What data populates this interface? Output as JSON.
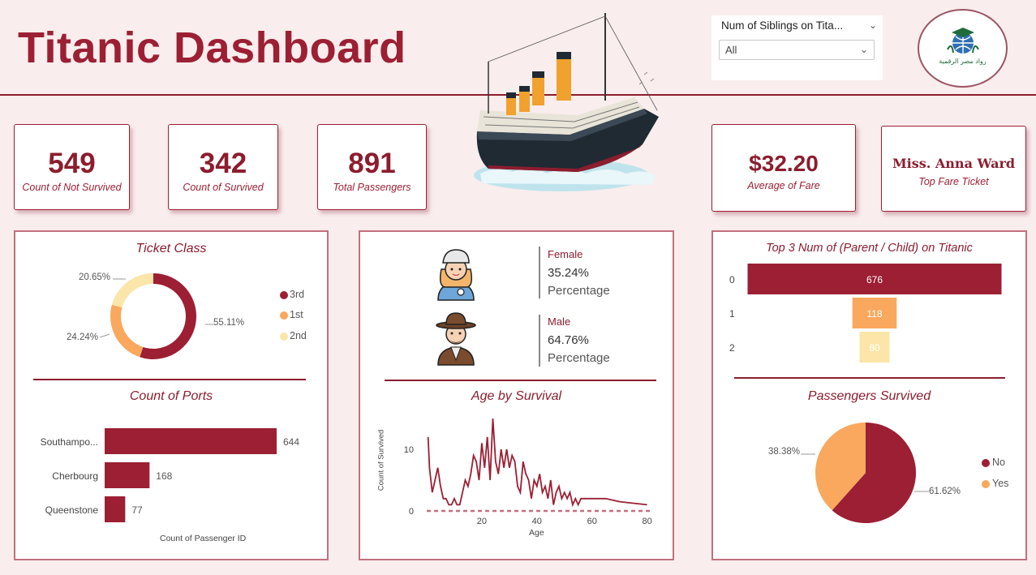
{
  "header": {
    "title": "Titanic Dashboard"
  },
  "slicer": {
    "label": "Num of Siblings on Tita...",
    "value": "All"
  },
  "logo": {
    "text": "رواد مصر الرقمية"
  },
  "kpis": {
    "not_survived": {
      "value": "549",
      "label": "Count of Not Survived"
    },
    "survived": {
      "value": "342",
      "label": "Count of Survived"
    },
    "total": {
      "value": "891",
      "label": "Total Passengers"
    },
    "avg_fare": {
      "value": "$32.20",
      "label": "Average of Fare"
    },
    "top_fare": {
      "value": "Miss. Anna Ward",
      "label": "Top Fare Ticket"
    }
  },
  "gender": {
    "female": {
      "title": "Female",
      "percent": "35.24%",
      "label": "Percentage"
    },
    "male": {
      "title": "Male",
      "percent": "64.76%",
      "label": "Percentage"
    }
  },
  "colors": {
    "primary": "#9c1f33",
    "orange": "#f9a85d",
    "cream": "#fbe5a8",
    "background": "#f9eded"
  },
  "icons": [
    "ship-illustration",
    "female-avatar-icon",
    "male-avatar-icon",
    "chevron-down-icon",
    "logo-icon"
  ],
  "chart_data": [
    {
      "type": "pie",
      "title": "Ticket Class",
      "donut": true,
      "categories": [
        "3rd",
        "1st",
        "2nd"
      ],
      "values": [
        55.11,
        24.24,
        20.65
      ],
      "labels": [
        "55.11%",
        "24.24%",
        "20.65%"
      ],
      "colors": [
        "#9c1f33",
        "#f9a85d",
        "#fbe5a8"
      ],
      "legend": "right"
    },
    {
      "type": "bar",
      "orientation": "horizontal",
      "title": "Count of Ports",
      "categories": [
        "Southampo...",
        "Cherbourg",
        "Queenstone"
      ],
      "values": [
        644,
        168,
        77
      ],
      "xlabel": "Count of Passenger ID"
    },
    {
      "type": "line",
      "title": "Age by Survival",
      "xlabel": "Age",
      "ylabel": "Count of Survived",
      "xlim": [
        0,
        81
      ],
      "ylim": [
        0,
        15
      ],
      "xticks": [
        "20",
        "40",
        "60",
        "80"
      ],
      "yticks": [
        "0",
        "10"
      ],
      "x": [
        0.5,
        1,
        2,
        3,
        4,
        5,
        6,
        7,
        8,
        9,
        10,
        11,
        12,
        13,
        14,
        15,
        16,
        17,
        18,
        19,
        20,
        21,
        22,
        23,
        24,
        25,
        26,
        27,
        28,
        29,
        30,
        31,
        32,
        33,
        34,
        35,
        36,
        37,
        38,
        39,
        40,
        41,
        42,
        43,
        44,
        45,
        46,
        47,
        48,
        49,
        50,
        51,
        52,
        53,
        54,
        55,
        56,
        58,
        60,
        62,
        65,
        70,
        80
      ],
      "y": [
        12,
        7,
        3,
        5,
        7,
        4,
        2,
        2,
        1,
        1,
        2,
        1,
        1,
        3,
        5,
        4,
        6,
        9,
        8,
        5,
        11,
        7,
        12,
        5,
        15,
        8,
        6,
        10,
        7,
        10,
        7,
        9,
        8,
        4,
        3,
        8,
        6,
        5,
        2,
        5,
        4,
        6,
        3,
        4,
        2,
        5,
        1,
        3,
        4,
        2,
        3,
        2,
        3,
        1,
        2,
        1,
        2,
        2,
        2,
        2,
        2,
        1.5,
        1
      ],
      "series": [
        {
          "name": "Count of Survived"
        }
      ]
    },
    {
      "type": "bar",
      "orientation": "horizontal",
      "title": "Top 3 Num of (Parent / Child) on Titanic",
      "categories": [
        "0",
        "1",
        "2"
      ],
      "values": [
        676,
        118,
        80
      ],
      "colors": [
        "#9c1f33",
        "#f9a85d",
        "#fbe5a8"
      ]
    },
    {
      "type": "pie",
      "title": "Passengers Survived",
      "categories": [
        "No",
        "Yes"
      ],
      "values": [
        61.62,
        38.38
      ],
      "labels": [
        "61.62%",
        "38.38%"
      ],
      "colors": [
        "#9c1f33",
        "#f9a85d"
      ],
      "legend": "right"
    }
  ]
}
